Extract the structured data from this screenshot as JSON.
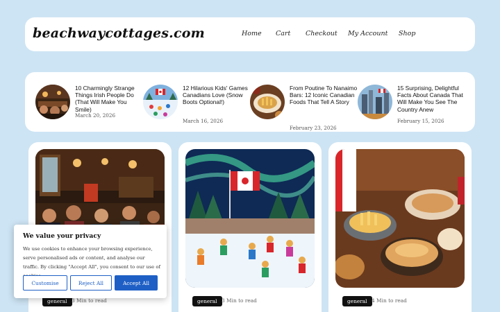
{
  "site": {
    "logo": "beachwaycottages.com",
    "nav": [
      "Home",
      "Cart",
      "Checkout",
      "My Account",
      "Shop"
    ]
  },
  "featured": [
    {
      "title": "10 Charmingly Strange Things Irish People Do (That Will Make You Smile)",
      "date": "March 20, 2026",
      "image": "irish-pub-image"
    },
    {
      "title": "12 Hilarious Kids' Games Canadians Love (Snow Boots Optional!)",
      "date": "March 16, 2026",
      "image": "kids-winter-image"
    },
    {
      "title": "From Poutine To Nanaimo Bars: 12 Iconic Canadian Foods That Tell A Story",
      "date": "February 23, 2026",
      "image": "canadian-food-image"
    },
    {
      "title": "15 Surprising, Delightful Facts About Canada That Will Make You See The Country Anew",
      "date": "February 15, 2026",
      "image": "canada-city-image"
    }
  ],
  "cards": [
    {
      "badge": "general",
      "read_time": "3 Min to read",
      "image": "pub-crowd-image"
    },
    {
      "badge": "general",
      "read_time": "3 Min to read",
      "image": "kids-skating-flag-image"
    },
    {
      "badge": "general",
      "read_time": "4 Min to read",
      "image": "canadian-food-spread-image"
    }
  ],
  "cookie": {
    "title": "We value your privacy",
    "text": "We use cookies to enhance your browsing experience, serve personalised ads or content, and analyse our traffic. By clicking \"Accept All\", you consent to our use of cookies.",
    "buttons": {
      "customise": "Customise",
      "reject": "Reject All",
      "accept": "Accept All"
    }
  },
  "colors": {
    "background": "#cde4f4",
    "accent": "#1e5fc5",
    "badge": "#111111"
  }
}
